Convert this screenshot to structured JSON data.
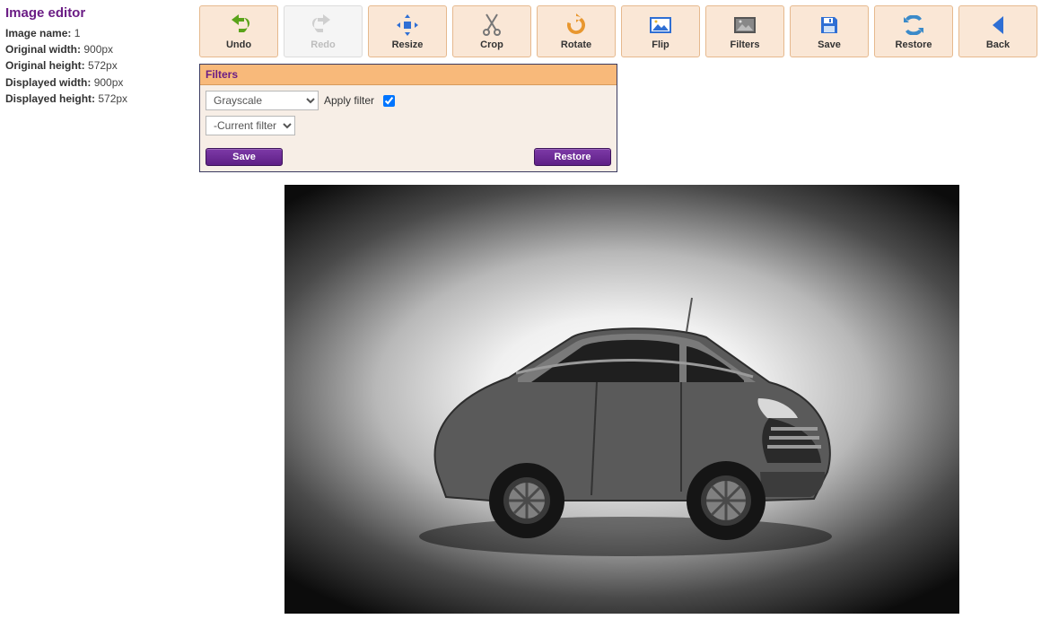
{
  "sidebar": {
    "title": "Image editor",
    "image_name_label": "Image name:",
    "image_name_value": "1",
    "original_width_label": "Original width:",
    "original_width_value": "900px",
    "original_height_label": "Original height:",
    "original_height_value": "572px",
    "displayed_width_label": "Displayed width:",
    "displayed_width_value": "900px",
    "displayed_height_label": "Displayed height:",
    "displayed_height_value": "572px"
  },
  "toolbar": {
    "undo": "Undo",
    "redo": "Redo",
    "resize": "Resize",
    "crop": "Crop",
    "rotate": "Rotate",
    "flip": "Flip",
    "filters": "Filters",
    "save": "Save",
    "restore": "Restore",
    "back": "Back"
  },
  "panel": {
    "title": "Filters",
    "filter_select_value": "Grayscale",
    "apply_label": "Apply filter",
    "apply_checked": true,
    "current_filters_value": "-Current filters-",
    "save": "Save",
    "restore": "Restore"
  },
  "colors": {
    "accent_purple": "#6b1d85",
    "toolbar_bg": "#fae7d6",
    "panel_header_bg": "#f8b97a"
  }
}
